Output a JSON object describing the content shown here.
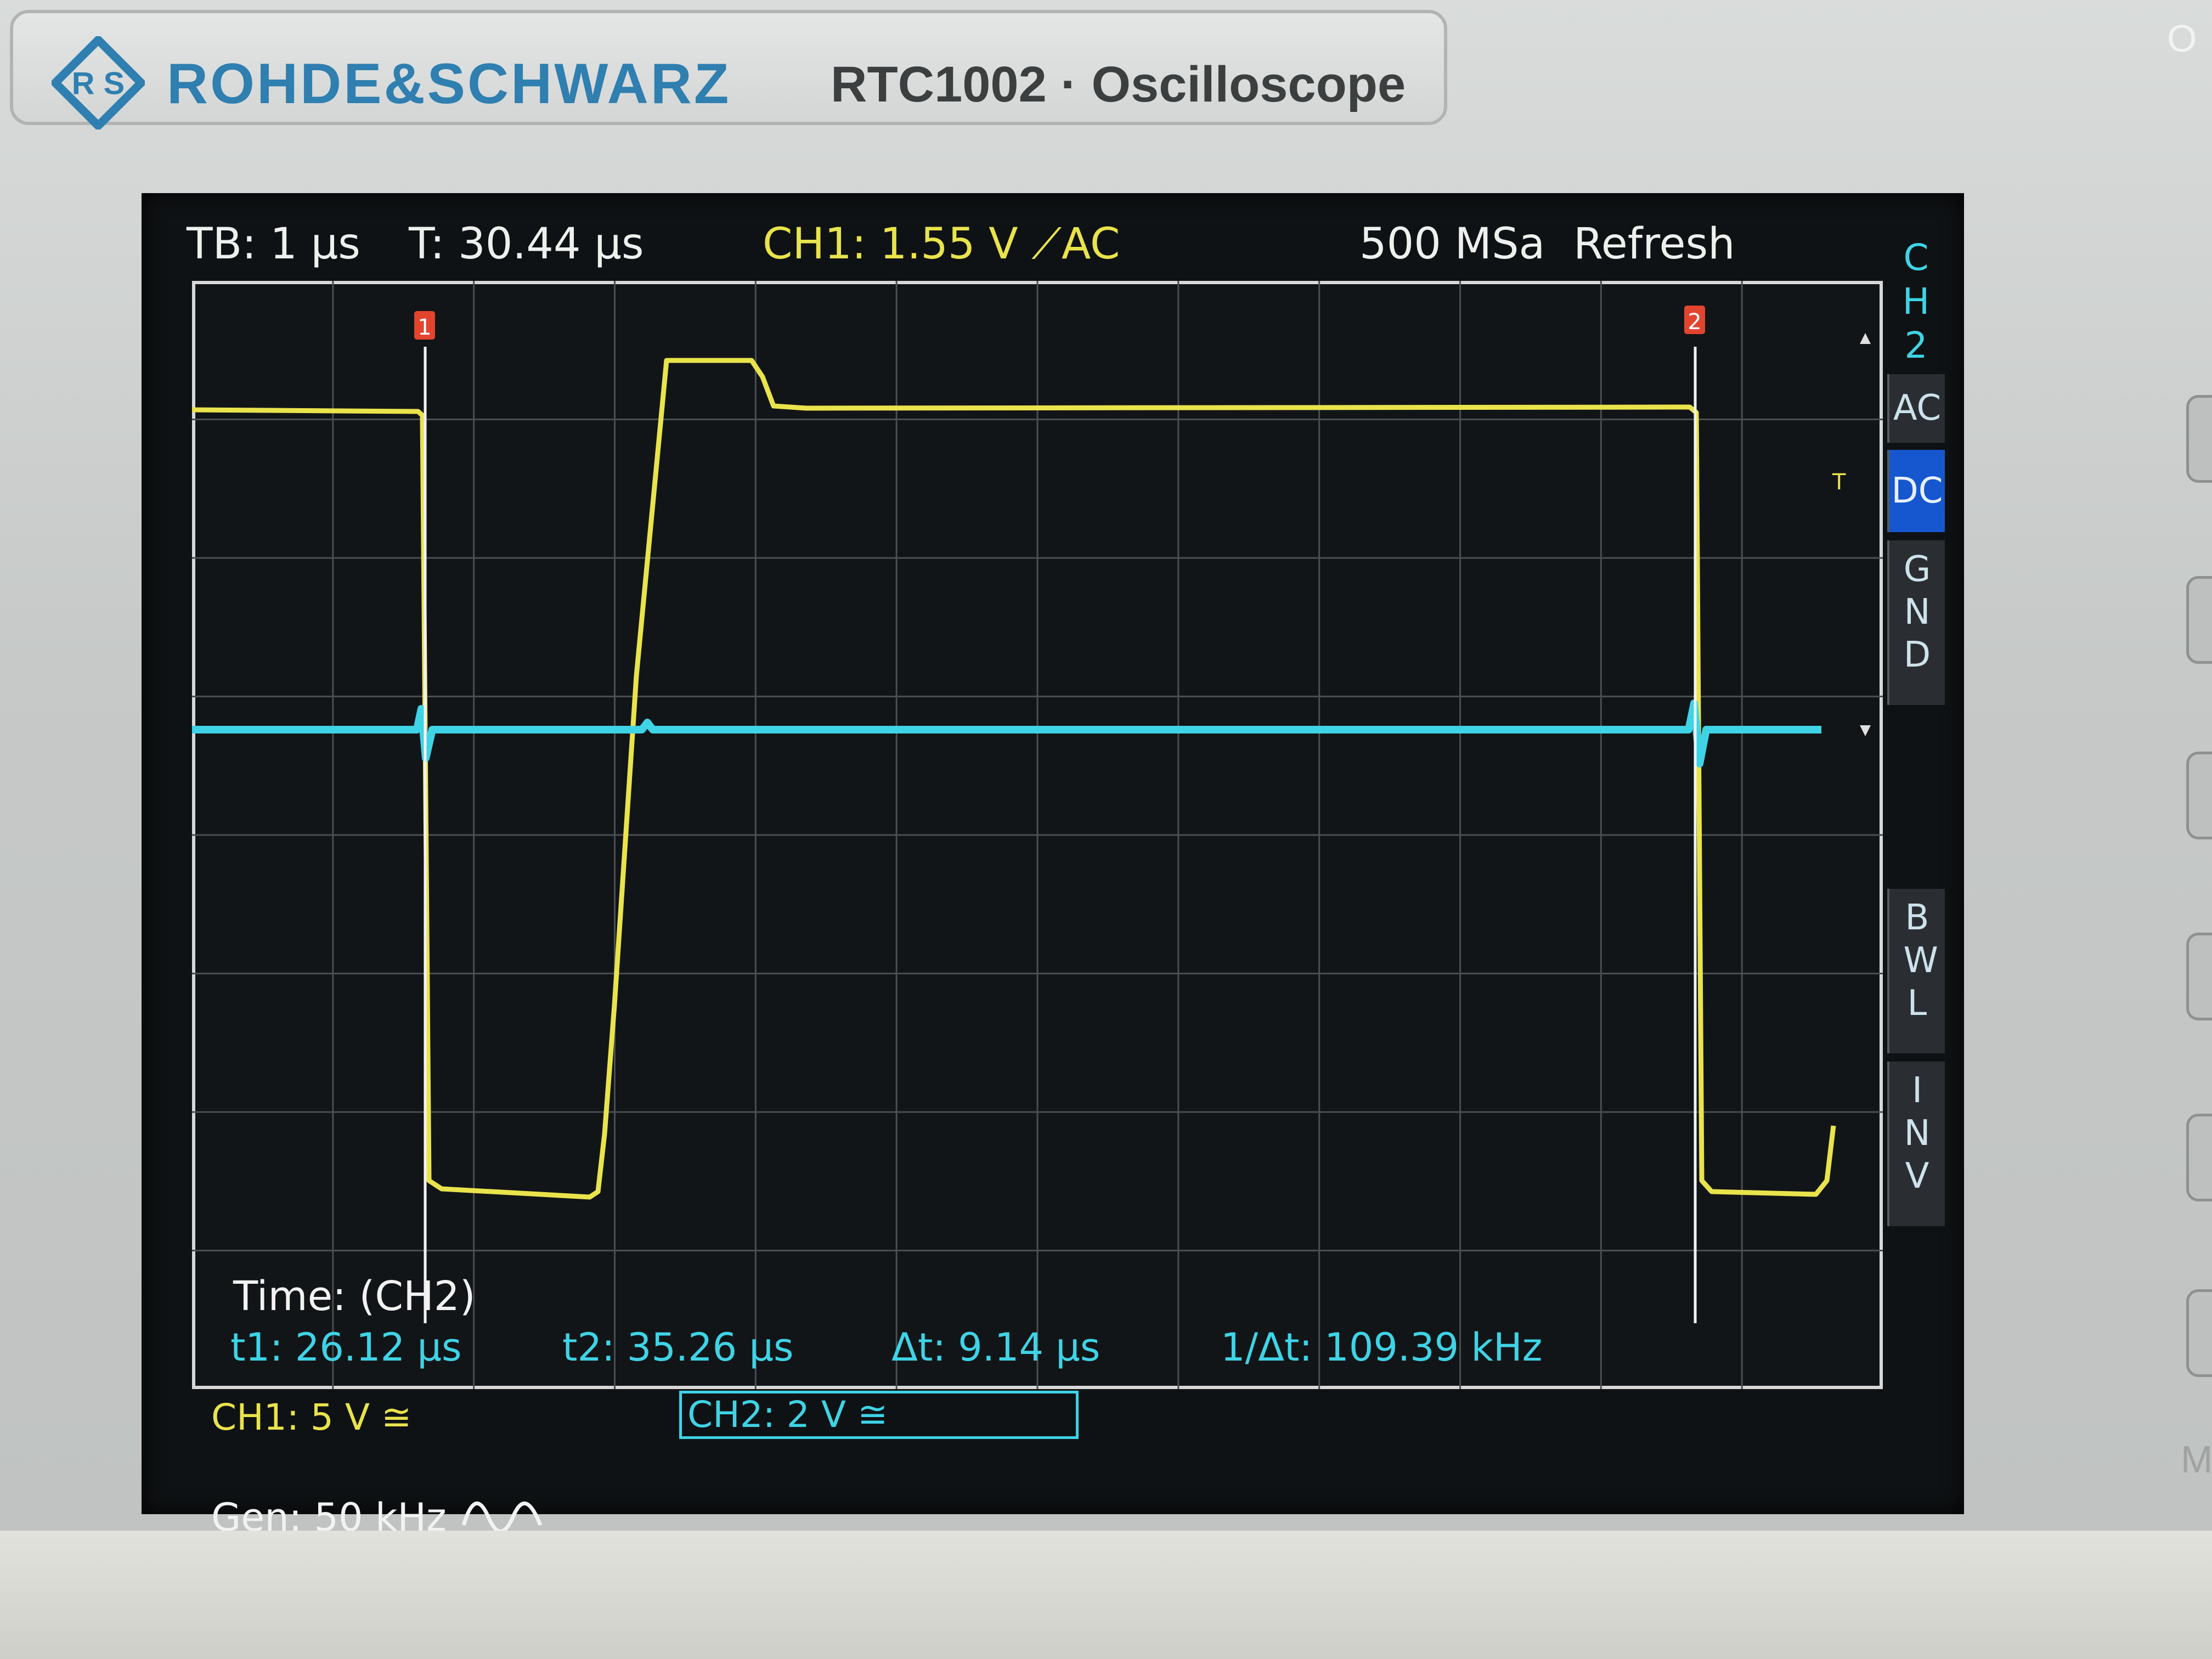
{
  "device": {
    "brand": "ROHDE&SCHWARZ",
    "model": "RTC1002 · Oscilloscope",
    "corner_top": "O",
    "corner_side": "M"
  },
  "header": {
    "timebase": "TB: 1 µs",
    "trigger_time": "T: 30.44 µs",
    "trigger_setting": "CH1: 1.55 V ⟋AC",
    "sample_rate": "500 MSa",
    "mode": "Refresh"
  },
  "channel_menu": {
    "title": "CH2",
    "ac_label": "AC",
    "dc_label": "DC",
    "gnd_label": "GND",
    "bwl_label": "BWL",
    "inv_label": "INV",
    "active_coupling": "DC"
  },
  "markers": {
    "cursor1": "1",
    "cursor2": "2",
    "ch1_ref": "1",
    "ch2_ref": "2",
    "trigger_level": "T"
  },
  "measurement": {
    "title": "Time: (CH2)",
    "t1": "t1: 26.12 µs",
    "t2": "t2: 35.26 µs",
    "dt": "Δt: 9.14 µs",
    "inv_dt": "1/Δt: 109.39 kHz"
  },
  "scales": {
    "ch1": "CH1: 5 V ≅",
    "ch2": "CH2: 2 V ≅"
  },
  "generator": {
    "label": "Gen:  50 kHz"
  },
  "colors": {
    "ch1_trace": "#e9e34c",
    "ch2_trace": "#3fd3e6",
    "active_button": "#1657cf",
    "cursor_marker": "#e2442e"
  }
}
